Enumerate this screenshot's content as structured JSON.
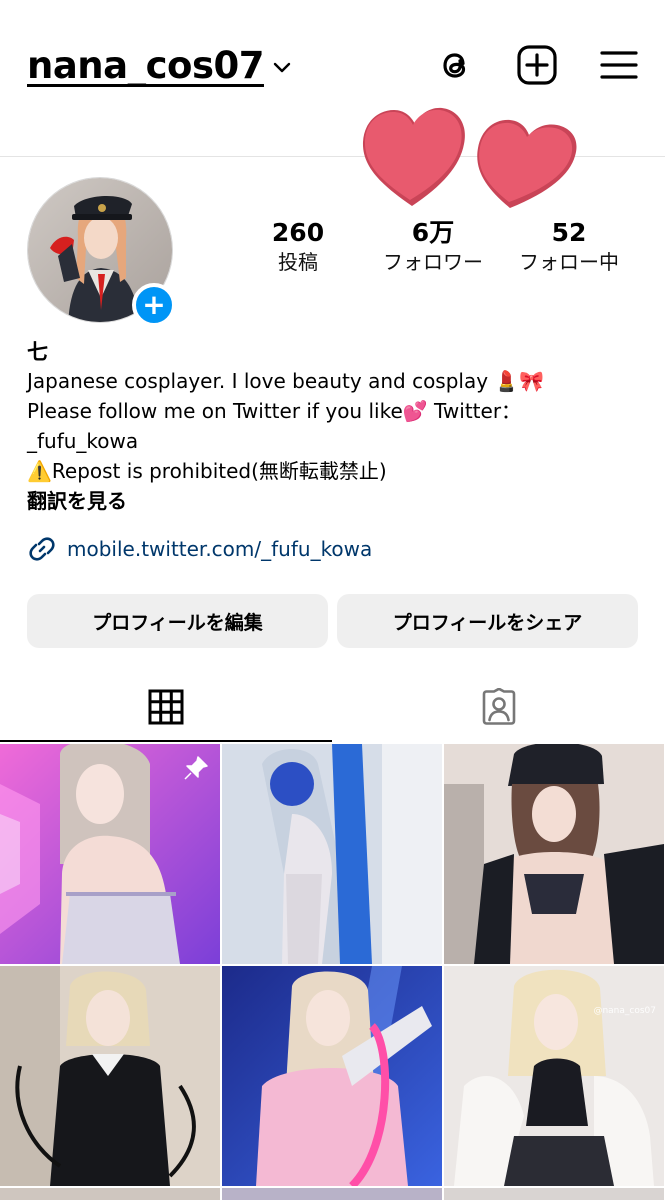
{
  "header": {
    "username": "nana_cos07",
    "icons": [
      "chevron-down-icon",
      "threads-icon",
      "create-post-icon",
      "menu-icon"
    ]
  },
  "stats": {
    "posts": {
      "value": "260",
      "label": "投稿"
    },
    "followers": {
      "value": "6万",
      "label": "フォロワー"
    },
    "following": {
      "value": "52",
      "label": "フォロー中"
    }
  },
  "bio": {
    "name": "七",
    "lines": [
      "Japanese cosplayer. I love beauty and cosplay 💄🎀",
      "Please follow me on Twitter if you like💕  Twitter：",
      "_fufu_kowa",
      "⚠️Repost is prohibited(無断転載禁止)"
    ],
    "translate": "翻訳を見る",
    "link": "mobile.twitter.com/_fufu_kowa"
  },
  "buttons": {
    "edit_profile": "プロフィールを編集",
    "share_profile": "プロフィールをシェア"
  },
  "tabs": [
    {
      "name": "posts-grid",
      "icon": "grid-icon",
      "active": true
    },
    {
      "name": "tagged",
      "icon": "tagged-person-icon",
      "active": false
    }
  ],
  "grid": {
    "watermark": "@nana_cos07"
  },
  "colors": {
    "accent": "#0095f6",
    "link": "#00376b",
    "button_bg": "#efefef",
    "heart": "#e85a6e"
  }
}
